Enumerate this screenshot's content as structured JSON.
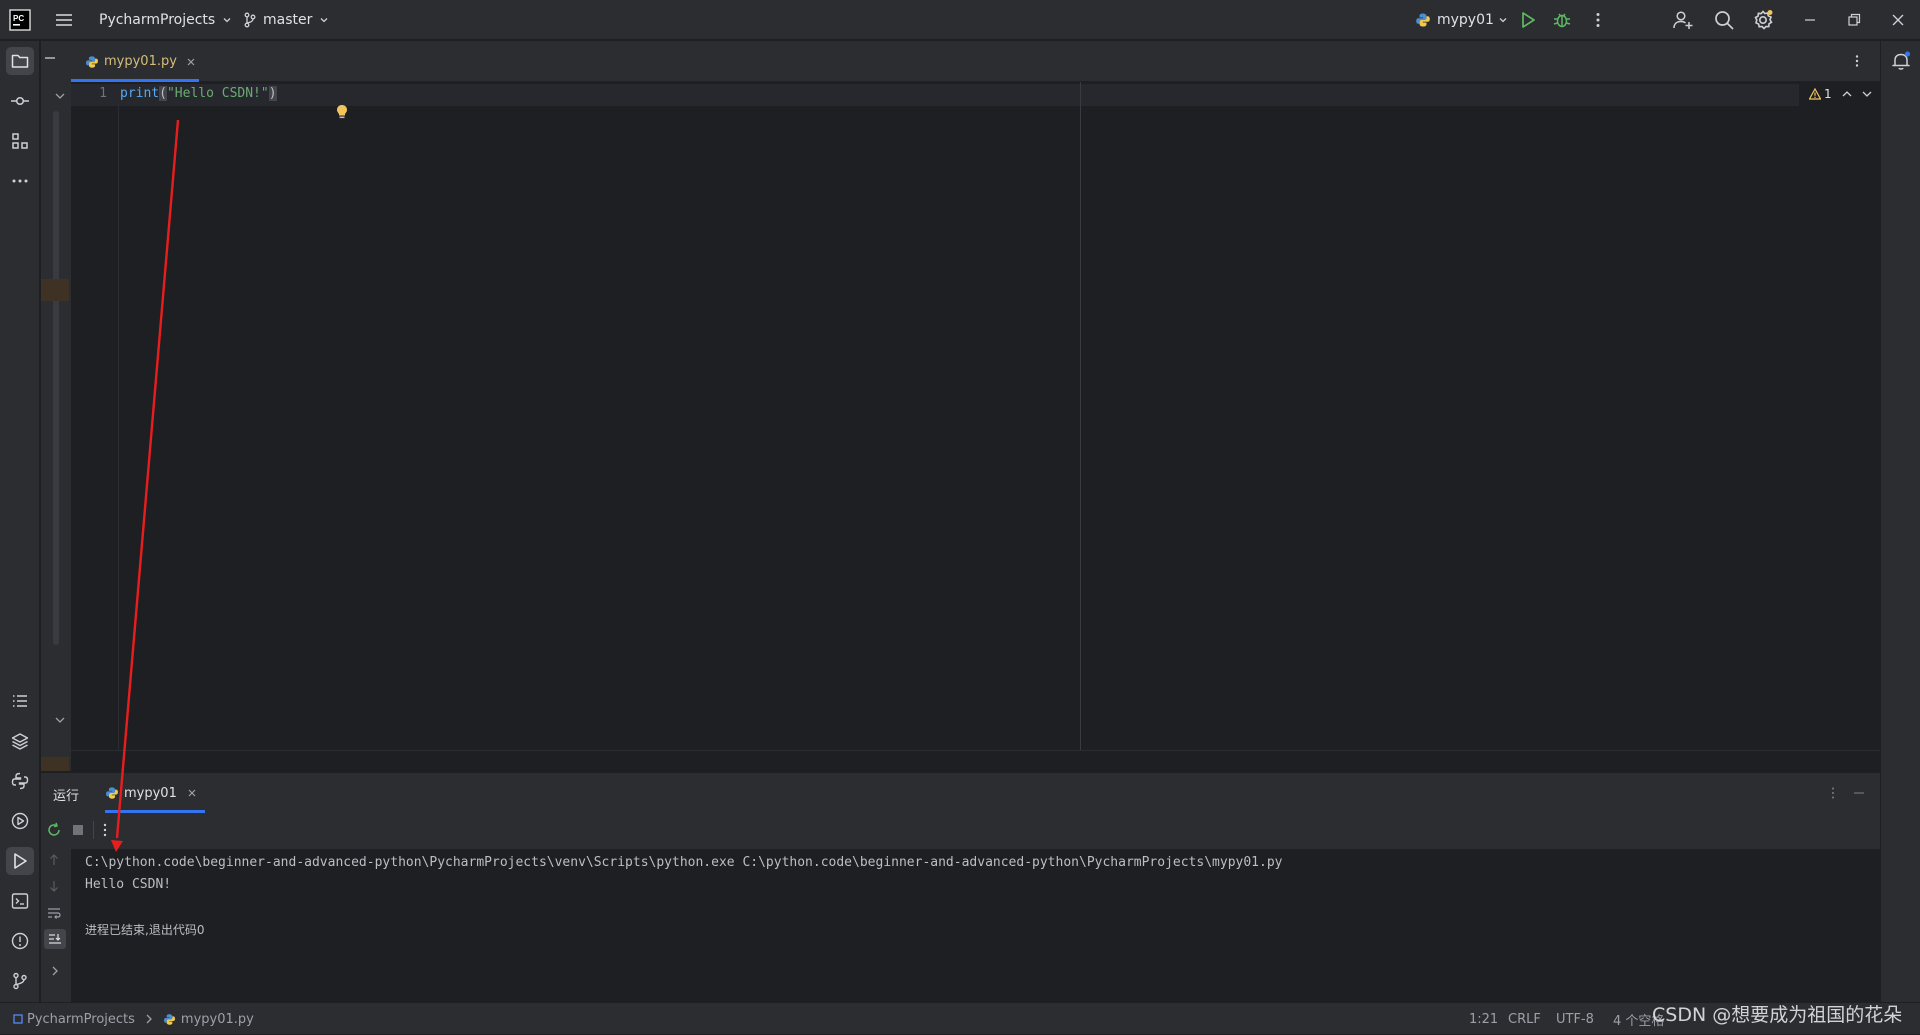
{
  "titlebar": {
    "project_name": "PycharmProjects",
    "branch": "master",
    "run_config": "mypy01"
  },
  "editor": {
    "tab_label": "mypy01.py",
    "line_number": "1",
    "code": {
      "fn": "print",
      "open": "(",
      "str": "\"Hello CSDN!\"",
      "close": ")"
    },
    "warning_count": "1"
  },
  "run_panel": {
    "title": "运行",
    "tab_label": "mypy01",
    "console": [
      "C:\\python.code\\beginner-and-advanced-python\\PycharmProjects\\venv\\Scripts\\python.exe C:\\python.code\\beginner-and-advanced-python\\PycharmProjects\\mypy01.py",
      "Hello CSDN!",
      "进程已结束,退出代码0"
    ]
  },
  "statusbar": {
    "breadcrumb_project": "PycharmProjects",
    "breadcrumb_file": "mypy01.py",
    "position": "1:21",
    "line_sep": "CRLF",
    "encoding": "UTF-8",
    "indent": "4 个空格"
  },
  "watermark": "CSDN @想要成为祖国的花朵",
  "colors": {
    "accent": "#3574f0",
    "run_green": "#5fb865",
    "arrow_red": "#e81e1e",
    "warning": "#f2c55c"
  }
}
